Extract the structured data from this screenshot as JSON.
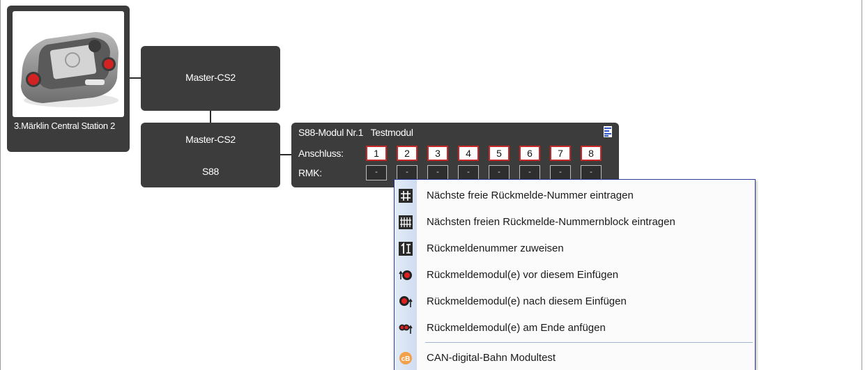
{
  "central_station": {
    "label": "3.Märklin Central Station 2"
  },
  "master_node_1": {
    "label": "Master-CS2"
  },
  "master_node_2": {
    "label": "Master-CS2",
    "sublabel": "S88"
  },
  "s88_module": {
    "title": "S88-Modul Nr.1   Testmodul",
    "port_row_label": "Anschluss:",
    "rmk_row_label": "RMK:",
    "ports": [
      "1",
      "2",
      "3",
      "4",
      "5",
      "6",
      "7",
      "8"
    ],
    "rmk_values": [
      "-",
      "-",
      "-",
      "-",
      "-",
      "-",
      "-",
      "-"
    ],
    "port_border_color": "#c82828"
  },
  "context_menu": {
    "items": [
      {
        "icon": "hash-single-icon",
        "label": "Nächste freie Rückmelde-Nummer eintragen"
      },
      {
        "icon": "hash-block-icon",
        "label": "Nächsten freien Rückmelde-Nummernblock eintragen"
      },
      {
        "icon": "assign-number-icon",
        "label": "Rückmeldenummer zuweisen"
      },
      {
        "icon": "insert-before-icon",
        "label": "Rückmeldemodul(e) vor diesem Einfügen"
      },
      {
        "icon": "insert-after-icon",
        "label": "Rückmeldemodul(e) nach diesem Einfügen"
      },
      {
        "icon": "append-end-icon",
        "label": "Rückmeldemodul(e) am Ende anfügen"
      },
      {
        "icon": "cdb-logo-icon",
        "label": "CAN-digital-Bahn Modultest"
      }
    ],
    "border_color": "#2b3c9a"
  },
  "colors": {
    "node_bg": "#3c3c3c",
    "node_text": "#ffffff"
  }
}
